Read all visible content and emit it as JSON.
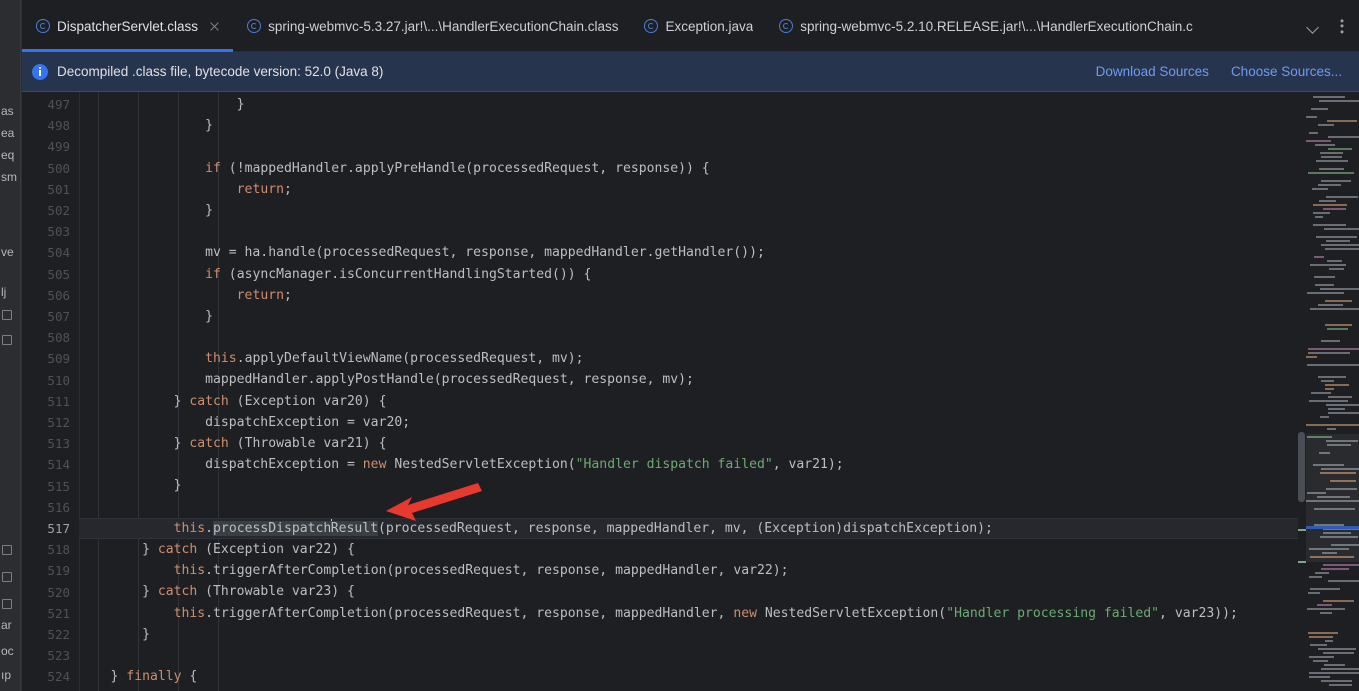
{
  "window": {
    "accent_blue": "#3574f0",
    "bg": "#1e1f22",
    "banner_bg": "#27344d"
  },
  "tabs": [
    {
      "label": "DispatcherServlet.class",
      "icon": "java-class-icon",
      "active": true,
      "closable": true
    },
    {
      "label": "spring-webmvc-5.3.27.jar!\\...\\HandlerExecutionChain.class",
      "icon": "java-class-icon",
      "active": false,
      "closable": false
    },
    {
      "label": "Exception.java",
      "icon": "java-class-icon",
      "active": false,
      "closable": false
    },
    {
      "label": "spring-webmvc-5.2.10.RELEASE.jar!\\...\\HandlerExecutionChain.c",
      "icon": "java-class-icon",
      "active": false,
      "closable": false
    }
  ],
  "tab_controls": {
    "dropdown": "chevron-down-icon",
    "more": "kebab-menu-icon"
  },
  "banner": {
    "icon": "info-icon",
    "text": "Decompiled .class file, bytecode version: 52.0 (Java 8)",
    "links": [
      {
        "label": "Download Sources"
      },
      {
        "label": "Choose Sources..."
      }
    ]
  },
  "editor": {
    "current_line": 517,
    "caret_token": "processDispatchResult",
    "first_line": 497,
    "last_line": 524,
    "lines": [
      {
        "n": 497,
        "html": "                    }"
      },
      {
        "n": 498,
        "html": "                }"
      },
      {
        "n": 499,
        "html": ""
      },
      {
        "n": 500,
        "html": "                <span class=\"kw\">if</span> (!mappedHandler.applyPreHandle(processedRequest, response)) {"
      },
      {
        "n": 501,
        "html": "                    <span class=\"kw\">return</span>;"
      },
      {
        "n": 502,
        "html": "                }"
      },
      {
        "n": 503,
        "html": ""
      },
      {
        "n": 504,
        "html": "                mv = ha.handle(processedRequest, response, mappedHandler.getHandler());"
      },
      {
        "n": 505,
        "html": "                <span class=\"kw\">if</span> (asyncManager.isConcurrentHandlingStarted()) {"
      },
      {
        "n": 506,
        "html": "                    <span class=\"kw\">return</span>;"
      },
      {
        "n": 507,
        "html": "                }"
      },
      {
        "n": 508,
        "html": ""
      },
      {
        "n": 509,
        "html": "                <span class=\"kw\">this</span>.applyDefaultViewName(processedRequest, mv);"
      },
      {
        "n": 510,
        "html": "                mappedHandler.applyPostHandle(processedRequest, response, mv);"
      },
      {
        "n": 511,
        "html": "            } <span class=\"kw\">catch</span> (Exception var20) {"
      },
      {
        "n": 512,
        "html": "                dispatchException = var20;"
      },
      {
        "n": 513,
        "html": "            } <span class=\"kw\">catch</span> (Throwable var21) {"
      },
      {
        "n": 514,
        "html": "                dispatchException = <span class=\"kw\">new</span> NestedServletException(<span class=\"str\">\"Handler dispatch failed\"</span>, var21);"
      },
      {
        "n": 515,
        "html": "            }"
      },
      {
        "n": 516,
        "html": ""
      },
      {
        "n": 517,
        "html": "            <span class=\"kw\">this</span>.<span class=\"hl\">processDispatch</span><span class=\"caret\"></span><span class=\"hl\">Result</span>(processedRequest, response, mappedHandler, mv, (Exception)dispatchException);"
      },
      {
        "n": 518,
        "html": "        } <span class=\"kw\">catch</span> (Exception var22) {"
      },
      {
        "n": 519,
        "html": "            <span class=\"kw\">this</span>.triggerAfterCompletion(processedRequest, response, mappedHandler, var22);"
      },
      {
        "n": 520,
        "html": "        } <span class=\"kw\">catch</span> (Throwable var23) {"
      },
      {
        "n": 521,
        "html": "            <span class=\"kw\">this</span>.triggerAfterCompletion(processedRequest, response, mappedHandler, <span class=\"kw\">new</span> NestedServletException(<span class=\"str\">\"Handler processing failed\"</span>, var23));"
      },
      {
        "n": 522,
        "html": "        }"
      },
      {
        "n": 523,
        "html": ""
      },
      {
        "n": 524,
        "html": "    } <span class=\"kw\">finally</span> {"
      }
    ],
    "syntax_colors": {
      "keyword": "#cf8e6d",
      "string": "#6aab73",
      "plain": "#bcbec4",
      "line_number": "#4e5157",
      "current_line_bg": "#26282e"
    }
  },
  "annotation": {
    "type": "red-arrow",
    "color": "#e8392e",
    "points_to": "processDispatchResult call on line 517"
  },
  "project_sliver": {
    "items": [
      {
        "text": "as"
      },
      {
        "text": "ea"
      },
      {
        "text": "eq"
      },
      {
        "text": "sm"
      },
      {
        "text": "ve"
      },
      {
        "text": "lj"
      },
      {
        "text": ""
      },
      {
        "text": ""
      },
      {
        "text": ""
      },
      {
        "text": ""
      },
      {
        "text": ""
      },
      {
        "text": ""
      },
      {
        "text": "ar"
      },
      {
        "text": "oc"
      },
      {
        "text": "ıp"
      }
    ]
  },
  "minimap": {
    "name": "code-minimap",
    "scrollbar": "vertical-scrollbar"
  }
}
